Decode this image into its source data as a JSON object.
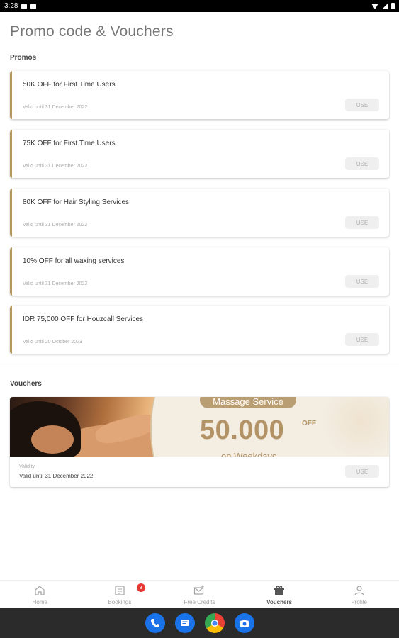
{
  "status_bar": {
    "time": "3:28"
  },
  "page": {
    "title": "Promo code & Vouchers"
  },
  "promos": {
    "section_title": "Promos",
    "items": [
      {
        "title": "50K OFF for First Time Users",
        "validity": "Valid until 31 December 2022",
        "button": "USE"
      },
      {
        "title": "75K OFF for First Time Users",
        "validity": "Valid until 31 December 2022",
        "button": "USE"
      },
      {
        "title": "80K OFF for Hair Styling Services",
        "validity": "Valid until 31 December 2022",
        "button": "USE"
      },
      {
        "title": "10% OFF for all waxing services",
        "validity": "Valid until 31 December 2022",
        "button": "USE"
      },
      {
        "title": "IDR 75,000 OFF for Houzcall Services",
        "validity": "Valid until 20 October 2023",
        "button": "USE"
      }
    ]
  },
  "vouchers": {
    "section_title": "Vouchers",
    "items": [
      {
        "banner": {
          "pill": "Massage Service",
          "amount": "50.000",
          "off": "OFF",
          "sub": "on Weekdays"
        },
        "validity_label": "Validity",
        "validity": "Valid until 31 December 2022",
        "button": "USE"
      }
    ]
  },
  "bottom_nav": {
    "items": [
      {
        "label": "Home",
        "icon": "home-icon"
      },
      {
        "label": "Bookings",
        "icon": "bookings-icon",
        "badge": "3"
      },
      {
        "label": "Free Credits",
        "icon": "free-credits-icon"
      },
      {
        "label": "Vouchers",
        "icon": "vouchers-icon",
        "active": true
      },
      {
        "label": "Profile",
        "icon": "profile-icon"
      }
    ]
  },
  "colors": {
    "accent": "#b8955f",
    "badge": "#e53935"
  }
}
